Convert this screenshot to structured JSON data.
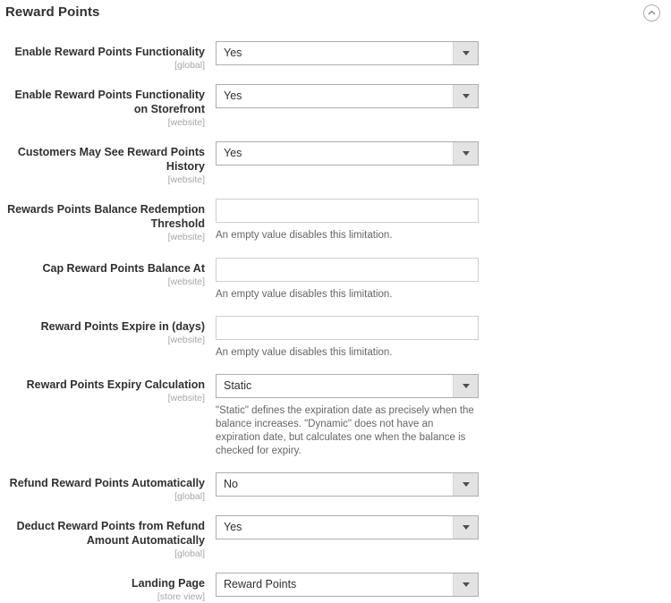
{
  "section": {
    "title": "Reward Points",
    "collapse_icon": "chevron-up-circle-icon",
    "collapse_title": "Collapse section"
  },
  "fields": [
    {
      "label": "Enable Reward Points Functionality",
      "scope": "[global]",
      "type": "select",
      "value": "Yes",
      "note": ""
    },
    {
      "label": "Enable Reward Points Functionality on Storefront",
      "scope": "[website]",
      "type": "select",
      "value": "Yes",
      "note": ""
    },
    {
      "label": "Customers May See Reward Points History",
      "scope": "[website]",
      "type": "select",
      "value": "Yes",
      "note": ""
    },
    {
      "label": "Rewards Points Balance Redemption Threshold",
      "scope": "[website]",
      "type": "text",
      "value": "",
      "placeholder": "",
      "note": "An empty value disables this limitation."
    },
    {
      "label": "Cap Reward Points Balance At",
      "scope": "[website]",
      "type": "text",
      "value": "",
      "placeholder": "",
      "note": "An empty value disables this limitation."
    },
    {
      "label": "Reward Points Expire in (days)",
      "scope": "[website]",
      "type": "text",
      "value": "",
      "placeholder": "",
      "note": "An empty value disables this limitation."
    },
    {
      "label": "Reward Points Expiry Calculation",
      "scope": "[website]",
      "type": "select",
      "value": "Static",
      "note": "\"Static\" defines the expiration date as precisely when the balance increases. \"Dynamic\" does not have an expiration date, but calculates one when the balance is checked for expiry."
    },
    {
      "label": "Refund Reward Points Automatically",
      "scope": "[global]",
      "type": "select",
      "value": "No",
      "note": ""
    },
    {
      "label": "Deduct Reward Points from Refund Amount Automatically",
      "scope": "[global]",
      "type": "select",
      "value": "Yes",
      "note": ""
    },
    {
      "label": "Landing Page",
      "scope": "[store view]",
      "type": "select",
      "value": "Reward Points",
      "note": ""
    }
  ],
  "colors": {
    "text": "#303030",
    "scope_text": "#a6a6a6",
    "note_text": "#666666",
    "select_border": "#adadad",
    "input_border": "#cecece",
    "arrow_button_bg": "#e3e3e3",
    "background": "#ffffff"
  }
}
